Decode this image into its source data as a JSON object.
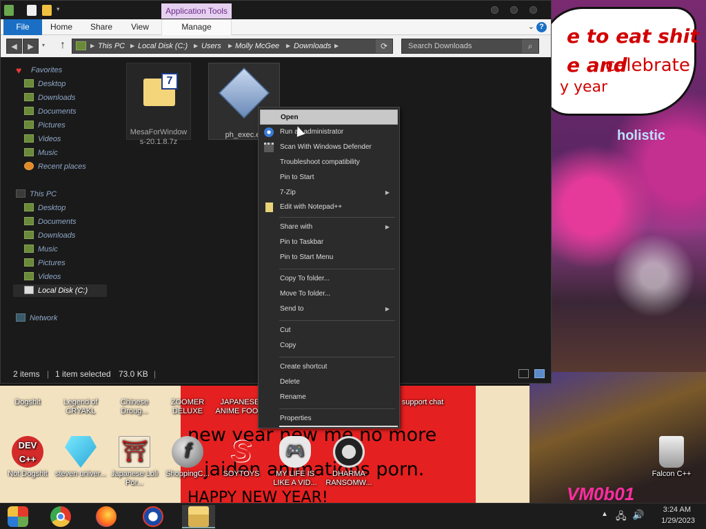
{
  "explorer": {
    "app_tools_label": "Application Tools",
    "tabs": [
      "File",
      "Home",
      "Share",
      "View",
      "Manage"
    ],
    "breadcrumb": [
      "This PC",
      "Local Disk (C:)",
      "Users",
      "Molly McGee",
      "Downloads"
    ],
    "search_placeholder": "Search Downloads",
    "nav": {
      "favorites": "Favorites",
      "favorites_items": [
        "Desktop",
        "Downloads",
        "Documents",
        "Pictures",
        "Videos",
        "Music",
        "Recent places"
      ],
      "this_pc": "This PC",
      "this_pc_items": [
        "Desktop",
        "Documents",
        "Downloads",
        "Music",
        "Pictures",
        "Videos",
        "Local Disk (C:)"
      ],
      "network": "Network"
    },
    "files": [
      {
        "name": "MesaForWindows-20.1.8.7z",
        "line1": "MesaForWindow",
        "line2": "s-20.1.8.7z"
      },
      {
        "name": "ph_exec.exe",
        "line1": "ph_exec.e"
      }
    ],
    "status": {
      "items": "2 items",
      "selected": "1 item selected",
      "size": "73.0 KB"
    }
  },
  "context_menu": {
    "open": "Open",
    "run_admin": "Run as administrator",
    "scan": "Scan With Windows Defender",
    "troubleshoot": "Troubleshoot compatibility",
    "pin_start": "Pin to Start",
    "sevenzip": "7-Zip",
    "notepad": "Edit with Notepad++",
    "share_with": "Share with",
    "pin_taskbar": "Pin to Taskbar",
    "pin_start_menu": "Pin to Start Menu",
    "copy_to": "Copy To folder...",
    "move_to": "Move To folder...",
    "send_to": "Send to",
    "cut": "Cut",
    "copy": "Copy",
    "create_shortcut": "Create shortcut",
    "delete": "Delete",
    "rename": "Rename",
    "properties": "Properties"
  },
  "desktop": {
    "row1": [
      "Dogshit",
      "Legend of CRYAKL",
      "Chinese Droug...",
      "ZOOMER DELUXE",
      "JAPANESE ANIME FOO...",
      "support chat"
    ],
    "row2": [
      "Not Dogshit",
      "steven univer...",
      "Japanese Loli Por...",
      "ShoppingC...",
      "SOYTOYS",
      "MY LIFE IS LIKE A VID...",
      "DHARMA RANSOMW...",
      "Falcon C++"
    ],
    "wallpaper_text": {
      "speech1": "e to eat shit",
      "speech2": "e and",
      "speech2b": "celebrate",
      "speech3": "y year",
      "holistic": "holistic",
      "red1": "new year new me no more",
      "red2": "jaiden animations porn.",
      "red3": "HAPPY NEW YEAR!",
      "signature": "VM0b01"
    }
  },
  "taskbar": {
    "time": "3:24 AM",
    "date": "1/29/2023"
  },
  "colors": {
    "accent": "#1a6fc4",
    "window_bg": "#1a1a1a",
    "menu_bg": "#2b2b2b",
    "app_tools": "#e6d0f0"
  }
}
